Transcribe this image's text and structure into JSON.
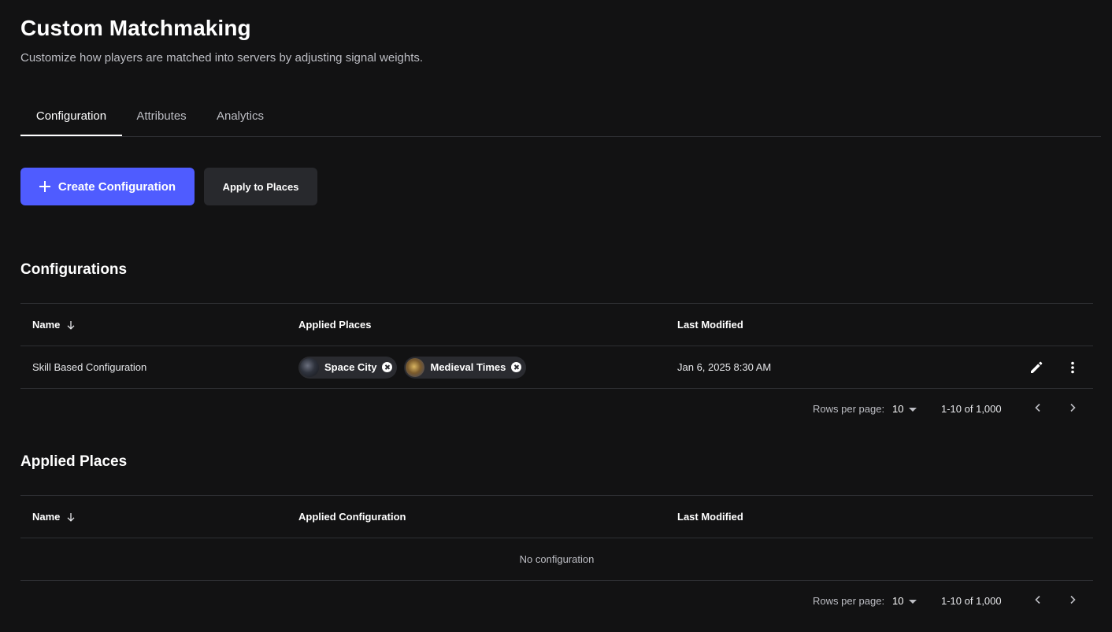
{
  "header": {
    "title": "Custom Matchmaking",
    "subtitle": "Customize how players are matched into servers by adjusting signal weights."
  },
  "tabs": [
    {
      "label": "Configuration",
      "active": true
    },
    {
      "label": "Attributes",
      "active": false
    },
    {
      "label": "Analytics",
      "active": false
    }
  ],
  "actions": {
    "create_label": "Create Configuration",
    "apply_label": "Apply to Places"
  },
  "configurations": {
    "title": "Configurations",
    "columns": {
      "name": "Name",
      "places": "Applied Places",
      "modified": "Last Modified"
    },
    "rows": [
      {
        "name": "Skill Based Configuration",
        "places": [
          {
            "label": "Space City",
            "thumb": "space-city-thumbnail"
          },
          {
            "label": "Medieval Times",
            "thumb": "medieval-times-thumbnail"
          }
        ],
        "modified": "Jan 6, 2025 8:30 AM"
      }
    ],
    "pager": {
      "rows_label": "Rows per page:",
      "rows_value": "10",
      "range": "1-10 of 1,000"
    }
  },
  "applied_places": {
    "title": "Applied Places",
    "columns": {
      "name": "Name",
      "config": "Applied Configuration",
      "modified": "Last Modified"
    },
    "empty_text": "No configuration",
    "pager": {
      "rows_label": "Rows per page:",
      "rows_value": "10",
      "range": "1-10 of 1,000"
    }
  },
  "colors": {
    "background": "#121213",
    "primary": "#4f5cff",
    "secondary_button": "#28292d",
    "chip": "#2a2b30",
    "divider": "#2e2f33"
  },
  "icons": [
    "plus-icon",
    "sort-down-icon",
    "close-circle-icon",
    "pencil-icon",
    "more-vertical-icon",
    "caret-down-icon",
    "chevron-left-icon",
    "chevron-right-icon"
  ]
}
